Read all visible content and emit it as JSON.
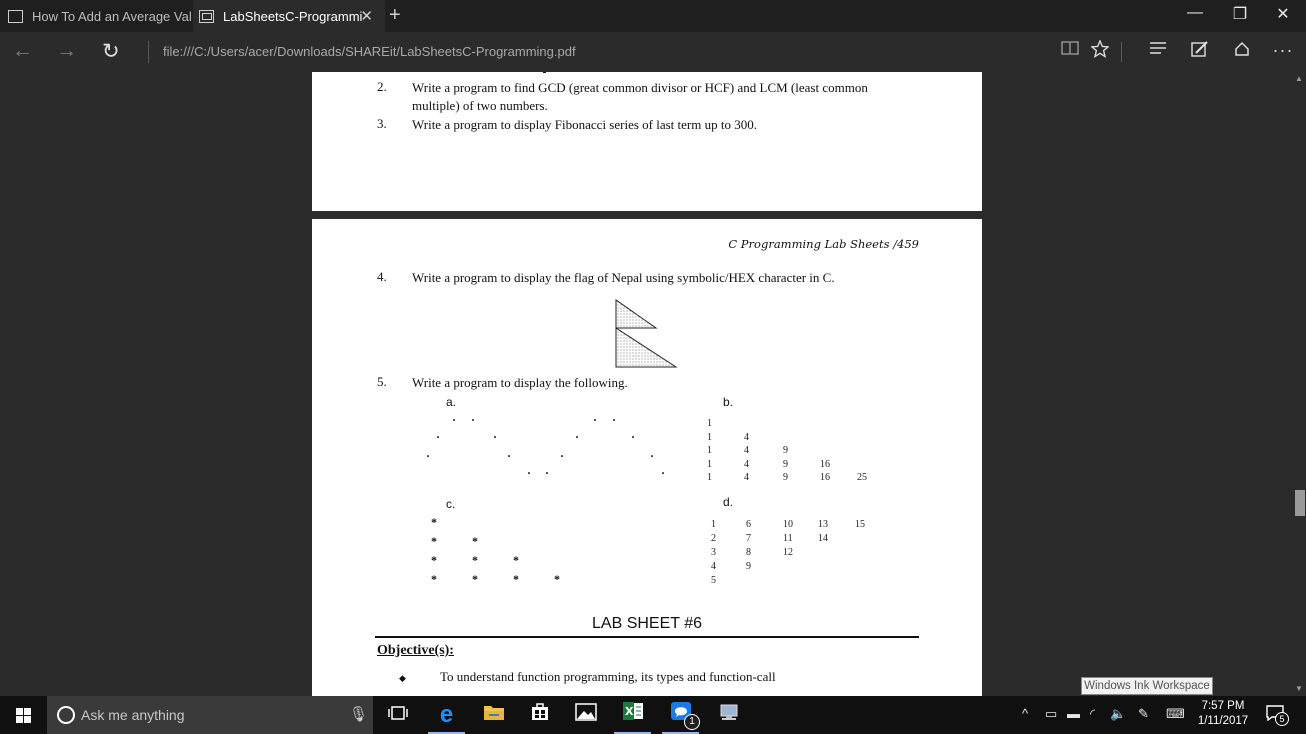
{
  "browser": {
    "tabs": [
      {
        "label": "How To Add an Average Val",
        "active": false
      },
      {
        "label": "LabSheetsC-Programmi",
        "active": true
      }
    ],
    "new_tab_symbol": "+",
    "close_tab_symbol": "✕",
    "window_controls": {
      "minimize": "—",
      "restore": "❐",
      "close": "✕"
    },
    "address": "file:///C:/Users/acer/Downloads/SHAREit/LabSheetsC-Programming.pdf",
    "nav": {
      "back": "←",
      "forward": "→",
      "refresh": "↻"
    },
    "toolbar_icons": [
      "reading-view-icon",
      "favorite-star-icon",
      "hub-icon",
      "web-note-icon",
      "share-icon",
      "more-icon"
    ]
  },
  "document": {
    "page1": {
      "items": [
        {
          "num": "2.",
          "text": "Write a program to find GCD (great common divisor or HCF) and LCM (least common",
          "cont": "multiple) of two numbers."
        },
        {
          "num": "3.",
          "text": "Write a program to display Fibonacci series of last term up to 300."
        }
      ]
    },
    "page2": {
      "header": "C Programming Lab Sheets /459",
      "item4": {
        "num": "4.",
        "text": "Write a program to display the flag of Nepal using symbolic/HEX character in C."
      },
      "item5": {
        "num": "5.",
        "text": "Write a program to display the following."
      },
      "labels": {
        "a": "a.",
        "b": "b.",
        "c": "c.",
        "d": "d."
      },
      "pattern_b": [
        [
          "1"
        ],
        [
          "1",
          "4"
        ],
        [
          "1",
          "4",
          "9"
        ],
        [
          "1",
          "4",
          "9",
          "16"
        ],
        [
          "1",
          "4",
          "9",
          "16",
          "25"
        ]
      ],
      "pattern_d": [
        [
          "1",
          "6",
          "10",
          "13",
          "15"
        ],
        [
          "2",
          "7",
          "11",
          "14"
        ],
        [
          "3",
          "8",
          "12"
        ],
        [
          "4",
          "9"
        ],
        [
          "5"
        ]
      ],
      "lab_title": "LAB SHEET #6",
      "objective_heading": "Objective(s):",
      "objective_bullet": "◆",
      "objective_text": "To understand function programming, its types and function-call"
    }
  },
  "ink_tooltip": "Windows Ink Workspace",
  "taskbar": {
    "search_placeholder": "Ask me anything",
    "messenger_badge": "1",
    "clock_time": "7:57 PM",
    "clock_date": "1/11/2017",
    "notification_count": "5"
  }
}
